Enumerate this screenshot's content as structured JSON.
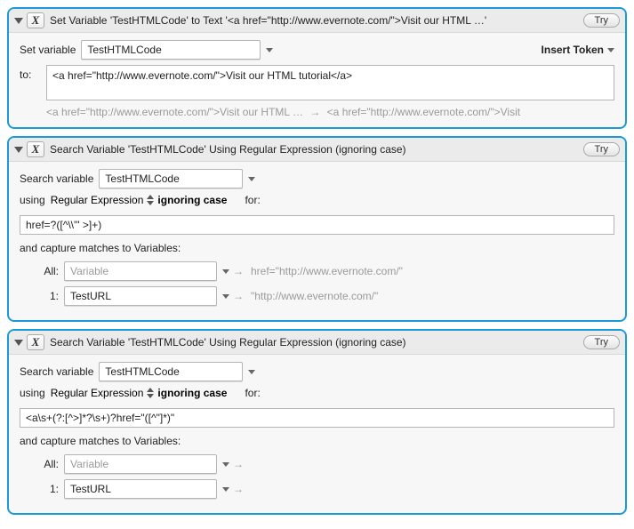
{
  "common": {
    "try_button": "Try",
    "icon_glyph": "X",
    "arrow": "→"
  },
  "action1": {
    "title": "Set Variable 'TestHTMLCode' to Text '<a href=\"http://www.evernote.com/\">Visit our HTML …'",
    "set_variable_label": "Set variable",
    "variable_name": "TestHTMLCode",
    "insert_token": "Insert Token",
    "to_label": "to:",
    "to_value": "<a href=\"http://www.evernote.com/\">Visit our HTML tutorial</a>",
    "preview_left": "<a href=\"http://www.evernote.com/\">Visit our HTML …",
    "preview_right": "<a href=\"http://www.evernote.com/\">Visit"
  },
  "action2": {
    "title": "Search Variable 'TestHTMLCode' Using Regular Expression (ignoring case)",
    "search_variable_label": "Search variable",
    "variable_name": "TestHTMLCode",
    "using_label": "using",
    "mode": "Regular Expression",
    "ignoring_case": "ignoring case",
    "for_label": "for:",
    "regex": "href=?([^\\\\'\" >]+)",
    "capture_heading": "and capture matches to Variables:",
    "all_label": "All:",
    "all_placeholder": "Variable",
    "all_preview": "href=\"http://www.evernote.com/\"",
    "one_label": "1:",
    "one_value": "TestURL",
    "one_preview": "\"http://www.evernote.com/\""
  },
  "action3": {
    "title": "Search Variable 'TestHTMLCode' Using Regular Expression (ignoring case)",
    "search_variable_label": "Search variable",
    "variable_name": "TestHTMLCode",
    "using_label": "using",
    "mode": "Regular Expression",
    "ignoring_case": "ignoring case",
    "for_label": "for:",
    "regex": "<a\\s+(?:[^>]*?\\s+)?href=\"([^\"]*)\"",
    "capture_heading": "and capture matches to Variables:",
    "all_label": "All:",
    "all_placeholder": "Variable",
    "all_preview": "",
    "one_label": "1:",
    "one_value": "TestURL",
    "one_preview": ""
  }
}
